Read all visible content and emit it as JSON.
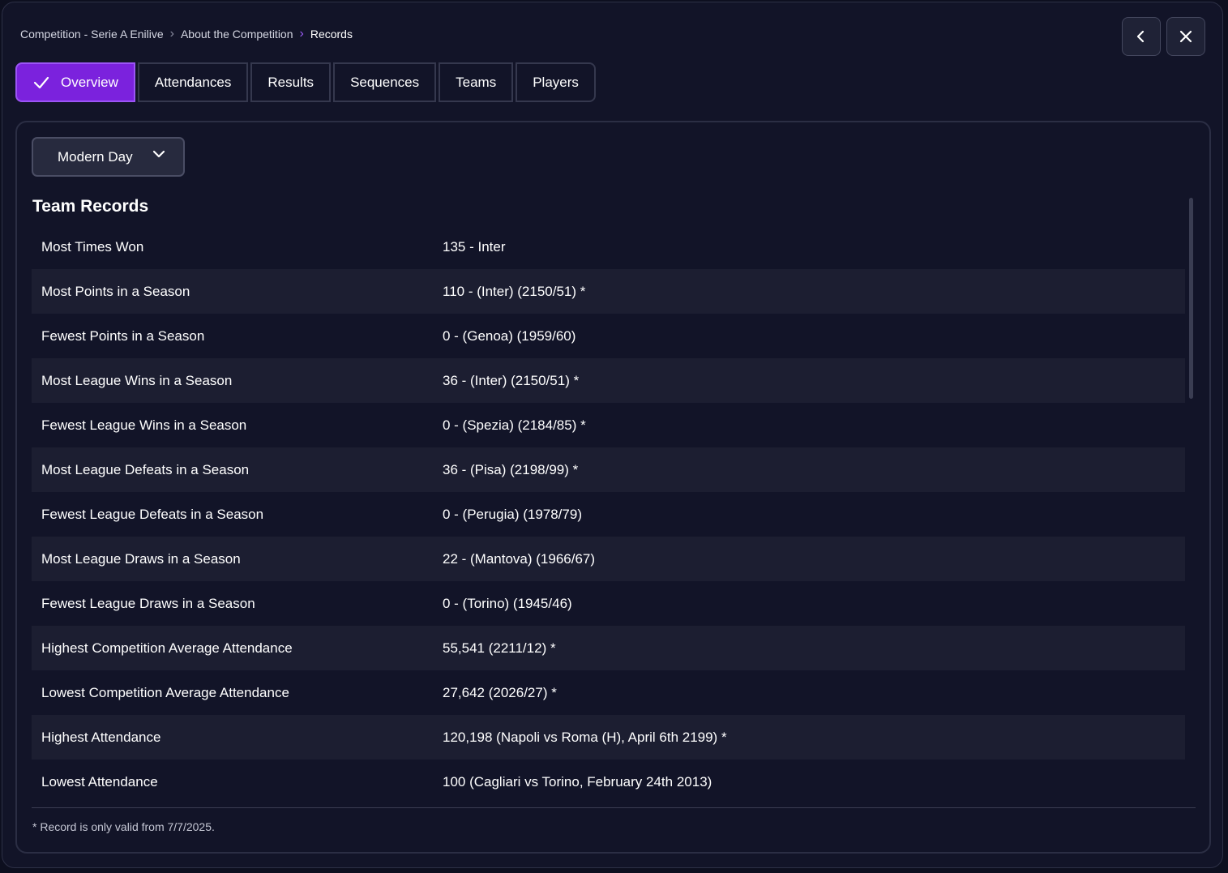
{
  "breadcrumb": {
    "items": [
      "Competition - Serie A Enilive",
      "About the Competition",
      "Records"
    ]
  },
  "nav": {
    "back_icon": "chevron-left-icon",
    "close_icon": "close-icon"
  },
  "tabs": [
    {
      "label": "Overview",
      "active": true
    },
    {
      "label": "Attendances"
    },
    {
      "label": "Results"
    },
    {
      "label": "Sequences"
    },
    {
      "label": "Teams"
    },
    {
      "label": "Players"
    }
  ],
  "filter": {
    "selected": "Modern Day"
  },
  "section_title": "Team Records",
  "records": [
    {
      "label": "Most Times Won",
      "value": "135 - Inter"
    },
    {
      "label": "Most Points in a Season",
      "value": "110 - (Inter) (2150/51) *"
    },
    {
      "label": "Fewest Points in a Season",
      "value": "0 - (Genoa) (1959/60)"
    },
    {
      "label": "Most League Wins in a Season",
      "value": "36 - (Inter) (2150/51) *"
    },
    {
      "label": "Fewest League Wins in a Season",
      "value": "0 - (Spezia) (2184/85) *"
    },
    {
      "label": "Most League Defeats in a Season",
      "value": "36 - (Pisa) (2198/99) *"
    },
    {
      "label": "Fewest League Defeats in a Season",
      "value": "0 - (Perugia) (1978/79)"
    },
    {
      "label": "Most League Draws in a Season",
      "value": "22 - (Mantova) (1966/67)"
    },
    {
      "label": "Fewest League Draws in a Season",
      "value": "0 - (Torino) (1945/46)"
    },
    {
      "label": "Highest Competition Average Attendance",
      "value": "55,541 (2211/12) *"
    },
    {
      "label": "Lowest Competition Average Attendance",
      "value": "27,642 (2026/27) *"
    },
    {
      "label": "Highest Attendance",
      "value": "120,198 (Napoli vs Roma (H), April 6th 2199) *"
    },
    {
      "label": "Lowest Attendance",
      "value": "100 (Cagliari vs Torino, February 24th 2013)"
    }
  ],
  "footnote": "* Record is only valid from 7/7/2025.",
  "colors": {
    "accent": "#7b22dd",
    "background": "#121428"
  }
}
